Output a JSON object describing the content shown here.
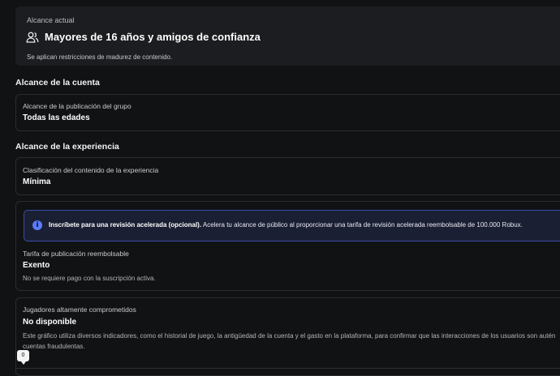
{
  "current_reach": {
    "label": "Alcance actual",
    "icon": "users-icon",
    "title": "Mayores de 16 años y amigos de confianza",
    "description": "Se aplican restricciones de madurez de contenido."
  },
  "account_reach": {
    "heading": "Alcance de la cuenta",
    "group_publication_label": "Alcance de la publicación del grupo",
    "group_publication_value": "Todas las edades"
  },
  "experience_reach": {
    "heading": "Alcance de la experiencia",
    "content_rating_label": "Clasificación del contenido de la experiencia",
    "content_rating_value": "Mínima"
  },
  "expedited_review": {
    "icon": "info-icon",
    "bold_text": "Inscríbete para una revisión acelerada (opcional).",
    "text": " Acelera tu alcance de público al proporcionar una tarifa de revisión acelerada reembolsable de 100.000 Robux.",
    "fee_label": "Tarifa de publicación reembolsable",
    "fee_value": "Exento",
    "fee_note": "No se requiere pago con la suscripción activa."
  },
  "engaged_players": {
    "label": "Jugadores altamente comprometidos",
    "value": "No disponible",
    "note": "Este gráfico utiliza diversos indicadores, como el historial de juego, la antigüedad de la cuenta y el gasto en la plataforma, para confirmar que las interacciones de los usuarios son autén cuentas fraudulentas."
  },
  "tooltip": {
    "value": "0"
  },
  "colors": {
    "accent": "#5b7cff",
    "background": "#111214",
    "card": "#1c1d20"
  }
}
